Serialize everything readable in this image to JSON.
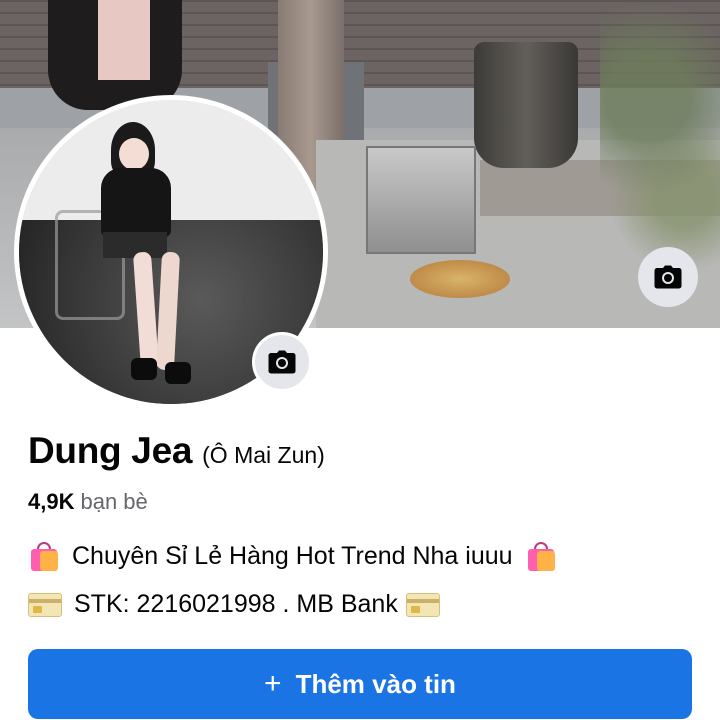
{
  "profile": {
    "name": "Dung Jea",
    "alternate_name": "(Ô Mai Zun)",
    "friends_count": "4,9K",
    "friends_label": "bạn bè"
  },
  "bio": {
    "line1": {
      "leading_icon": "shopping-bags-icon",
      "text": "Chuyên Sỉ Lẻ Hàng Hot Trend Nha iuuu",
      "trailing_icon": "shopping-bags-icon"
    },
    "line2": {
      "leading_icon": "credit-card-icon",
      "text": "STK: 2216021998 . MB Bank",
      "trailing_icon": "credit-card-icon"
    }
  },
  "actions": {
    "add_story_icon": "plus-icon",
    "add_story_label": "Thêm vào tin",
    "edit_cover_icon": "camera-icon",
    "edit_avatar_icon": "camera-icon"
  },
  "colors": {
    "primary_button": "#1b74e4",
    "secondary_text": "#65676b",
    "camera_button_bg": "#e4e6eb"
  }
}
